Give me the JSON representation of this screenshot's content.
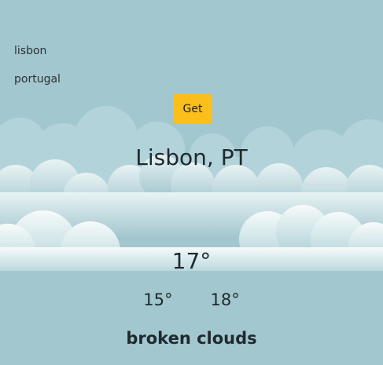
{
  "search": {
    "city_value": "lisbon",
    "country_value": "portugal",
    "button_label": "Get"
  },
  "weather": {
    "location": "Lisbon, PT",
    "temperature": "17°",
    "temp_min": "15°",
    "temp_max": "18°",
    "description": "broken clouds"
  },
  "colors": {
    "sky": "#a2c7cf",
    "button": "#fbbf1b",
    "text": "#1f2a2e"
  }
}
